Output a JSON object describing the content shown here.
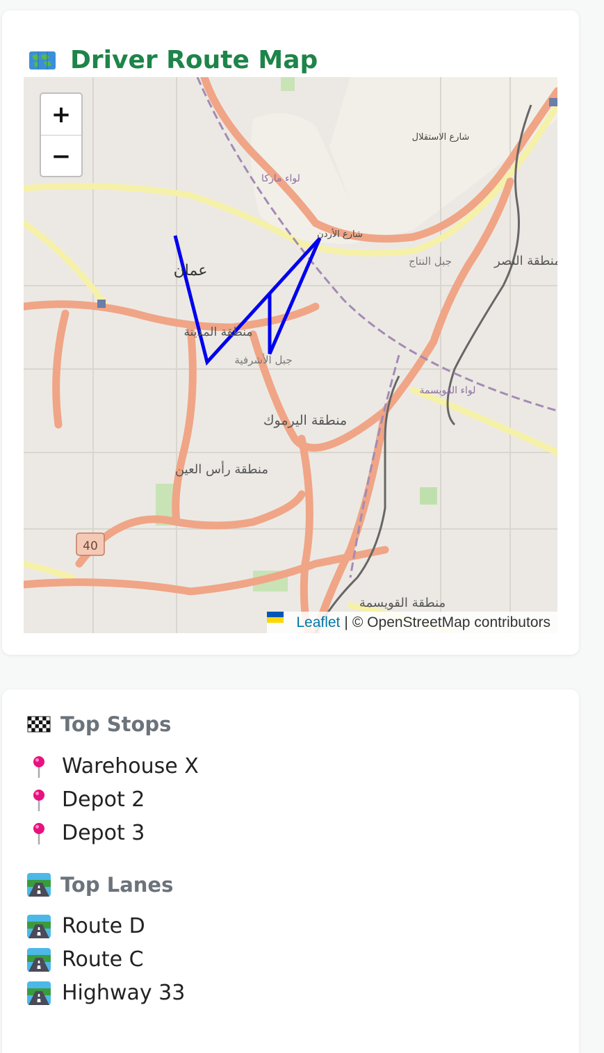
{
  "map_card": {
    "title": "Driver Route Map",
    "title_icon": "world-map-icon",
    "title_color": "#1e8449",
    "zoom_in_label": "+",
    "zoom_out_label": "−",
    "attribution": {
      "leaflet_label": "Leaflet",
      "separator": "|",
      "osm_label": "© OpenStreetMap contributors"
    },
    "map_labels": [
      "عمان",
      "منطقة المدينة",
      "منطقة اليرموك",
      "منطقة رأس العين",
      "منطقة القويسمة",
      "منطقة النصر",
      "جبل الأشرفية",
      "جبل النتاج",
      "شارع الأردن",
      "لواء ماركا",
      "لواء القويسمة",
      "شارع الاستقلال",
      "40"
    ],
    "route_color": "#0000ee"
  },
  "stops_card": {
    "top_stops": {
      "title": "Top Stops",
      "icon": "checkered-flag-icon",
      "items": [
        {
          "label": "Warehouse X",
          "icon": "pushpin-icon"
        },
        {
          "label": "Depot 2",
          "icon": "pushpin-icon"
        },
        {
          "label": "Depot 3",
          "icon": "pushpin-icon"
        }
      ]
    },
    "top_lanes": {
      "title": "Top Lanes",
      "icon": "motorway-icon",
      "items": [
        {
          "label": "Route D",
          "icon": "motorway-icon"
        },
        {
          "label": "Route C",
          "icon": "motorway-icon"
        },
        {
          "label": "Highway 33",
          "icon": "motorway-icon"
        }
      ]
    }
  }
}
